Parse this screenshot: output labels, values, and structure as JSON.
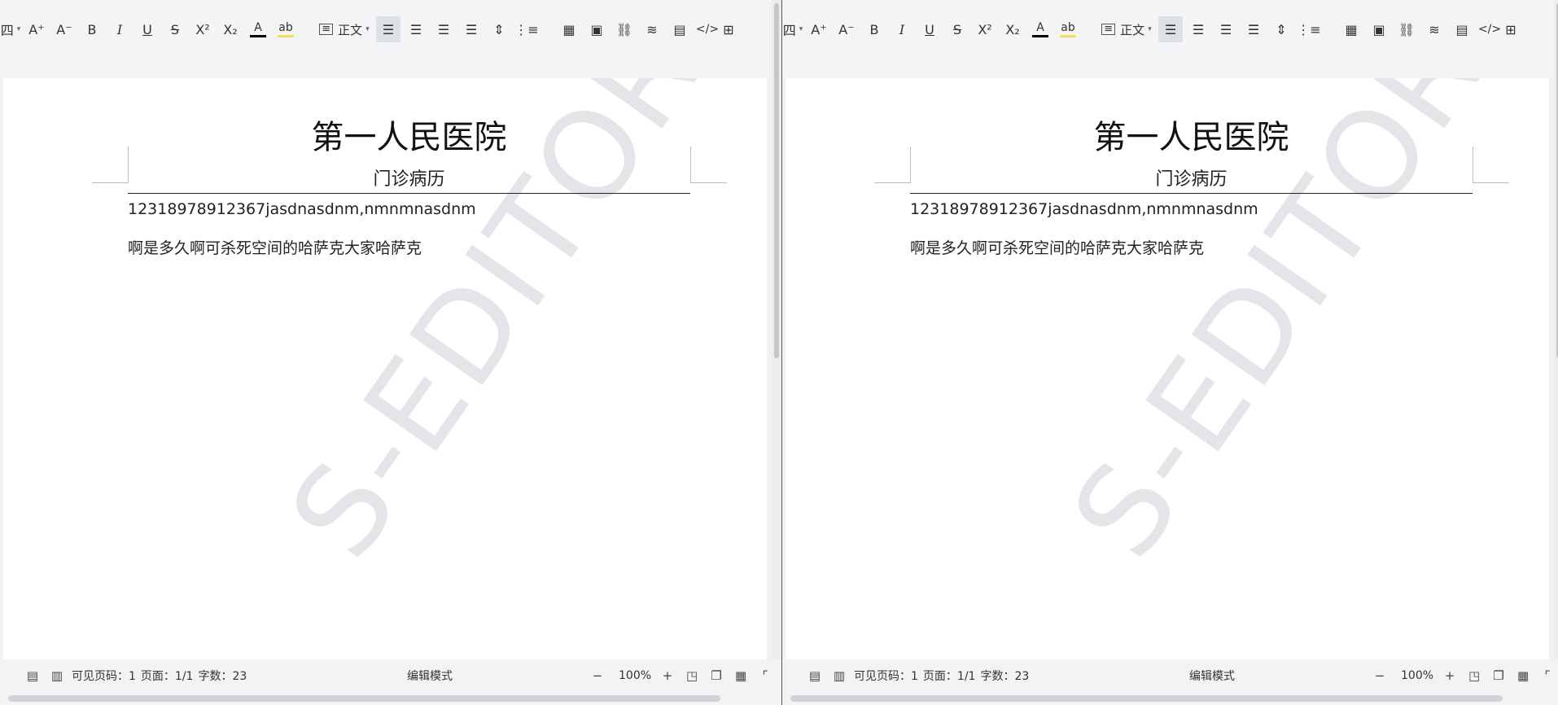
{
  "toolbar": {
    "font_size_label": "四",
    "increase_font": "A⁺",
    "decrease_font": "A⁻",
    "bold": "B",
    "italic": "I",
    "underline": "U",
    "strike": "S",
    "superscript": "X²",
    "subscript": "X₂",
    "font_color": "A",
    "highlight": "ab",
    "style_label": "正文",
    "colors": {
      "font_color_bar": "#000000",
      "highlight_bar": "#f0e060",
      "active_bg": "#dde0e6"
    }
  },
  "document": {
    "title": "第一人民医院",
    "subtitle": "门诊病历",
    "paragraph_1": "12318978912367jasdnasdnm,nmnmnasdnm",
    "paragraph_2": "啊是多久啊可杀死空间的哈萨克大家哈萨克",
    "watermark": "S-EDITOR"
  },
  "footer": {
    "visible_page_label": "可见页码：1",
    "page_label": "页面：1/1",
    "word_count_label": "字数：23",
    "mode_label": "编辑模式",
    "zoom_value": "100%"
  }
}
